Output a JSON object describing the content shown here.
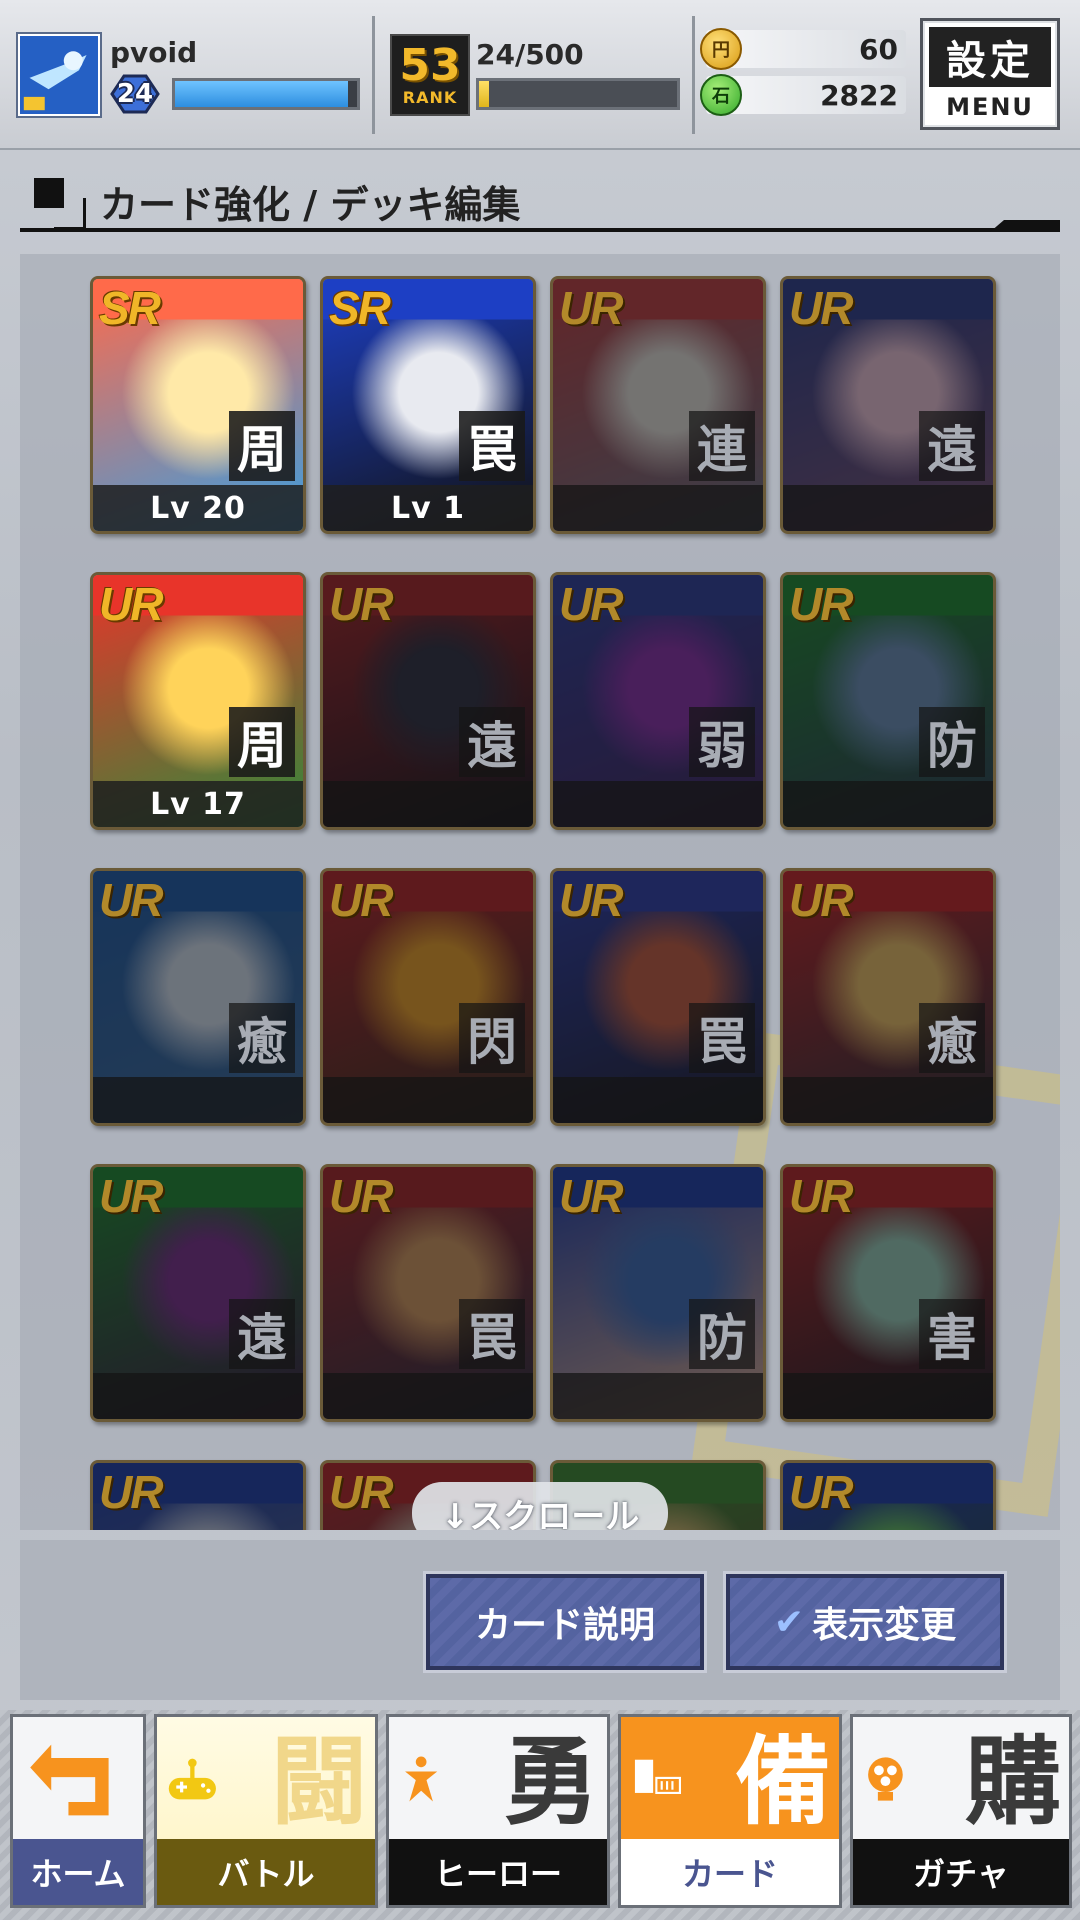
{
  "player": {
    "name": "pvoid",
    "level": "24",
    "exp_fraction": 0.95
  },
  "rank": {
    "value": "53",
    "label": "RANK",
    "count": "24/500",
    "progress_fraction": 0.048
  },
  "currency": {
    "gold": "60",
    "gold_coin_mark": "円",
    "green": "2822",
    "green_coin_mark": "石"
  },
  "menu": {
    "kanji": "設定",
    "label": "MENU"
  },
  "page": {
    "title": "カード強化 / デッキ編集"
  },
  "cards": [
    {
      "rarity": "SR",
      "kanji": "周",
      "level": "Lv 20",
      "owned": true,
      "palette": [
        "#ff6a4a",
        "#ffe9a8",
        "#3a9ee0"
      ]
    },
    {
      "rarity": "SR",
      "kanji": "罠",
      "level": "Lv 1",
      "owned": true,
      "palette": [
        "#1d3fc4",
        "#e8eaf0",
        "#111111"
      ]
    },
    {
      "rarity": "UR",
      "kanji": "連",
      "level": "",
      "owned": false,
      "palette": [
        "#c23a3a",
        "#e9e4da",
        "#6a7080"
      ]
    },
    {
      "rarity": "UR",
      "kanji": "遠",
      "level": "",
      "owned": false,
      "palette": [
        "#2a3a8a",
        "#f2c6d8",
        "#7a5070"
      ]
    },
    {
      "rarity": "UR",
      "kanji": "周",
      "level": "Lv 17",
      "owned": true,
      "palette": [
        "#e8342a",
        "#ffd35a",
        "#2f8a3a"
      ]
    },
    {
      "rarity": "UR",
      "kanji": "遠",
      "level": "",
      "owned": false,
      "palette": [
        "#a82020",
        "#2a2a3a",
        "#101018"
      ]
    },
    {
      "rarity": "UR",
      "kanji": "弱",
      "level": "",
      "owned": false,
      "palette": [
        "#2a3a9a",
        "#8a2aa8",
        "#40205a"
      ]
    },
    {
      "rarity": "UR",
      "kanji": "防",
      "level": "",
      "owned": false,
      "palette": [
        "#1a8a2a",
        "#6a90b8",
        "#2a3a50"
      ]
    },
    {
      "rarity": "UR",
      "kanji": "癒",
      "level": "",
      "owned": false,
      "palette": [
        "#1a5aa8",
        "#d8e4f0",
        "#3a6a9a"
      ]
    },
    {
      "rarity": "UR",
      "kanji": "閃",
      "level": "",
      "owned": false,
      "palette": [
        "#b82020",
        "#f0a020",
        "#3a2a1a"
      ]
    },
    {
      "rarity": "UR",
      "kanji": "罠",
      "level": "",
      "owned": false,
      "palette": [
        "#2a3aa8",
        "#c85a3a",
        "#1a1a2a"
      ]
    },
    {
      "rarity": "UR",
      "kanji": "癒",
      "level": "",
      "owned": false,
      "palette": [
        "#c82020",
        "#f0c060",
        "#2a2a30"
      ]
    },
    {
      "rarity": "UR",
      "kanji": "遠",
      "level": "",
      "owned": false,
      "palette": [
        "#1a8a2a",
        "#7a2a8a",
        "#3a1a40"
      ]
    },
    {
      "rarity": "UR",
      "kanji": "罠",
      "level": "",
      "owned": false,
      "palette": [
        "#a82020",
        "#d89a5a",
        "#2a2a3a"
      ]
    },
    {
      "rarity": "UR",
      "kanji": "防",
      "level": "",
      "owned": false,
      "palette": [
        "#1a3aa8",
        "#3a6ab8",
        "#e0b090"
      ]
    },
    {
      "rarity": "UR",
      "kanji": "害",
      "level": "",
      "owned": false,
      "palette": [
        "#b82020",
        "#9ad0b8",
        "#1a1a22"
      ]
    },
    {
      "rarity": "UR",
      "kanji": "",
      "level": "",
      "owned": false,
      "palette": [
        "#1a3aa8",
        "#d0d8e8",
        "#5a6a80"
      ]
    },
    {
      "rarity": "UR",
      "kanji": "",
      "level": "",
      "owned": false,
      "palette": [
        "#b82020",
        "#d0c0a8",
        "#3a3a40"
      ]
    },
    {
      "rarity": "",
      "kanji": "",
      "level": "",
      "owned": false,
      "palette": [
        "#3a8a2a",
        "#e0c070",
        "#5a4a30"
      ]
    },
    {
      "rarity": "UR",
      "kanji": "",
      "level": "",
      "owned": false,
      "palette": [
        "#1a3aa8",
        "#6ad05a",
        "#2a4a2a"
      ]
    }
  ],
  "scroll_hint": "↓スクロール",
  "actions": {
    "card_desc": "カード説明",
    "display_change": "表示変更"
  },
  "nav": {
    "home": "ホーム",
    "battle": "バトル",
    "battle_kanji": "闘",
    "hero": "ヒーロー",
    "hero_kanji": "勇",
    "card": "カード",
    "card_kanji": "備",
    "gacha": "ガチャ",
    "gacha_kanji": "購",
    "active": "card"
  },
  "colors": {
    "accent": "#f7931e",
    "button": "#5d6aa8",
    "gold": "#f0b628"
  }
}
